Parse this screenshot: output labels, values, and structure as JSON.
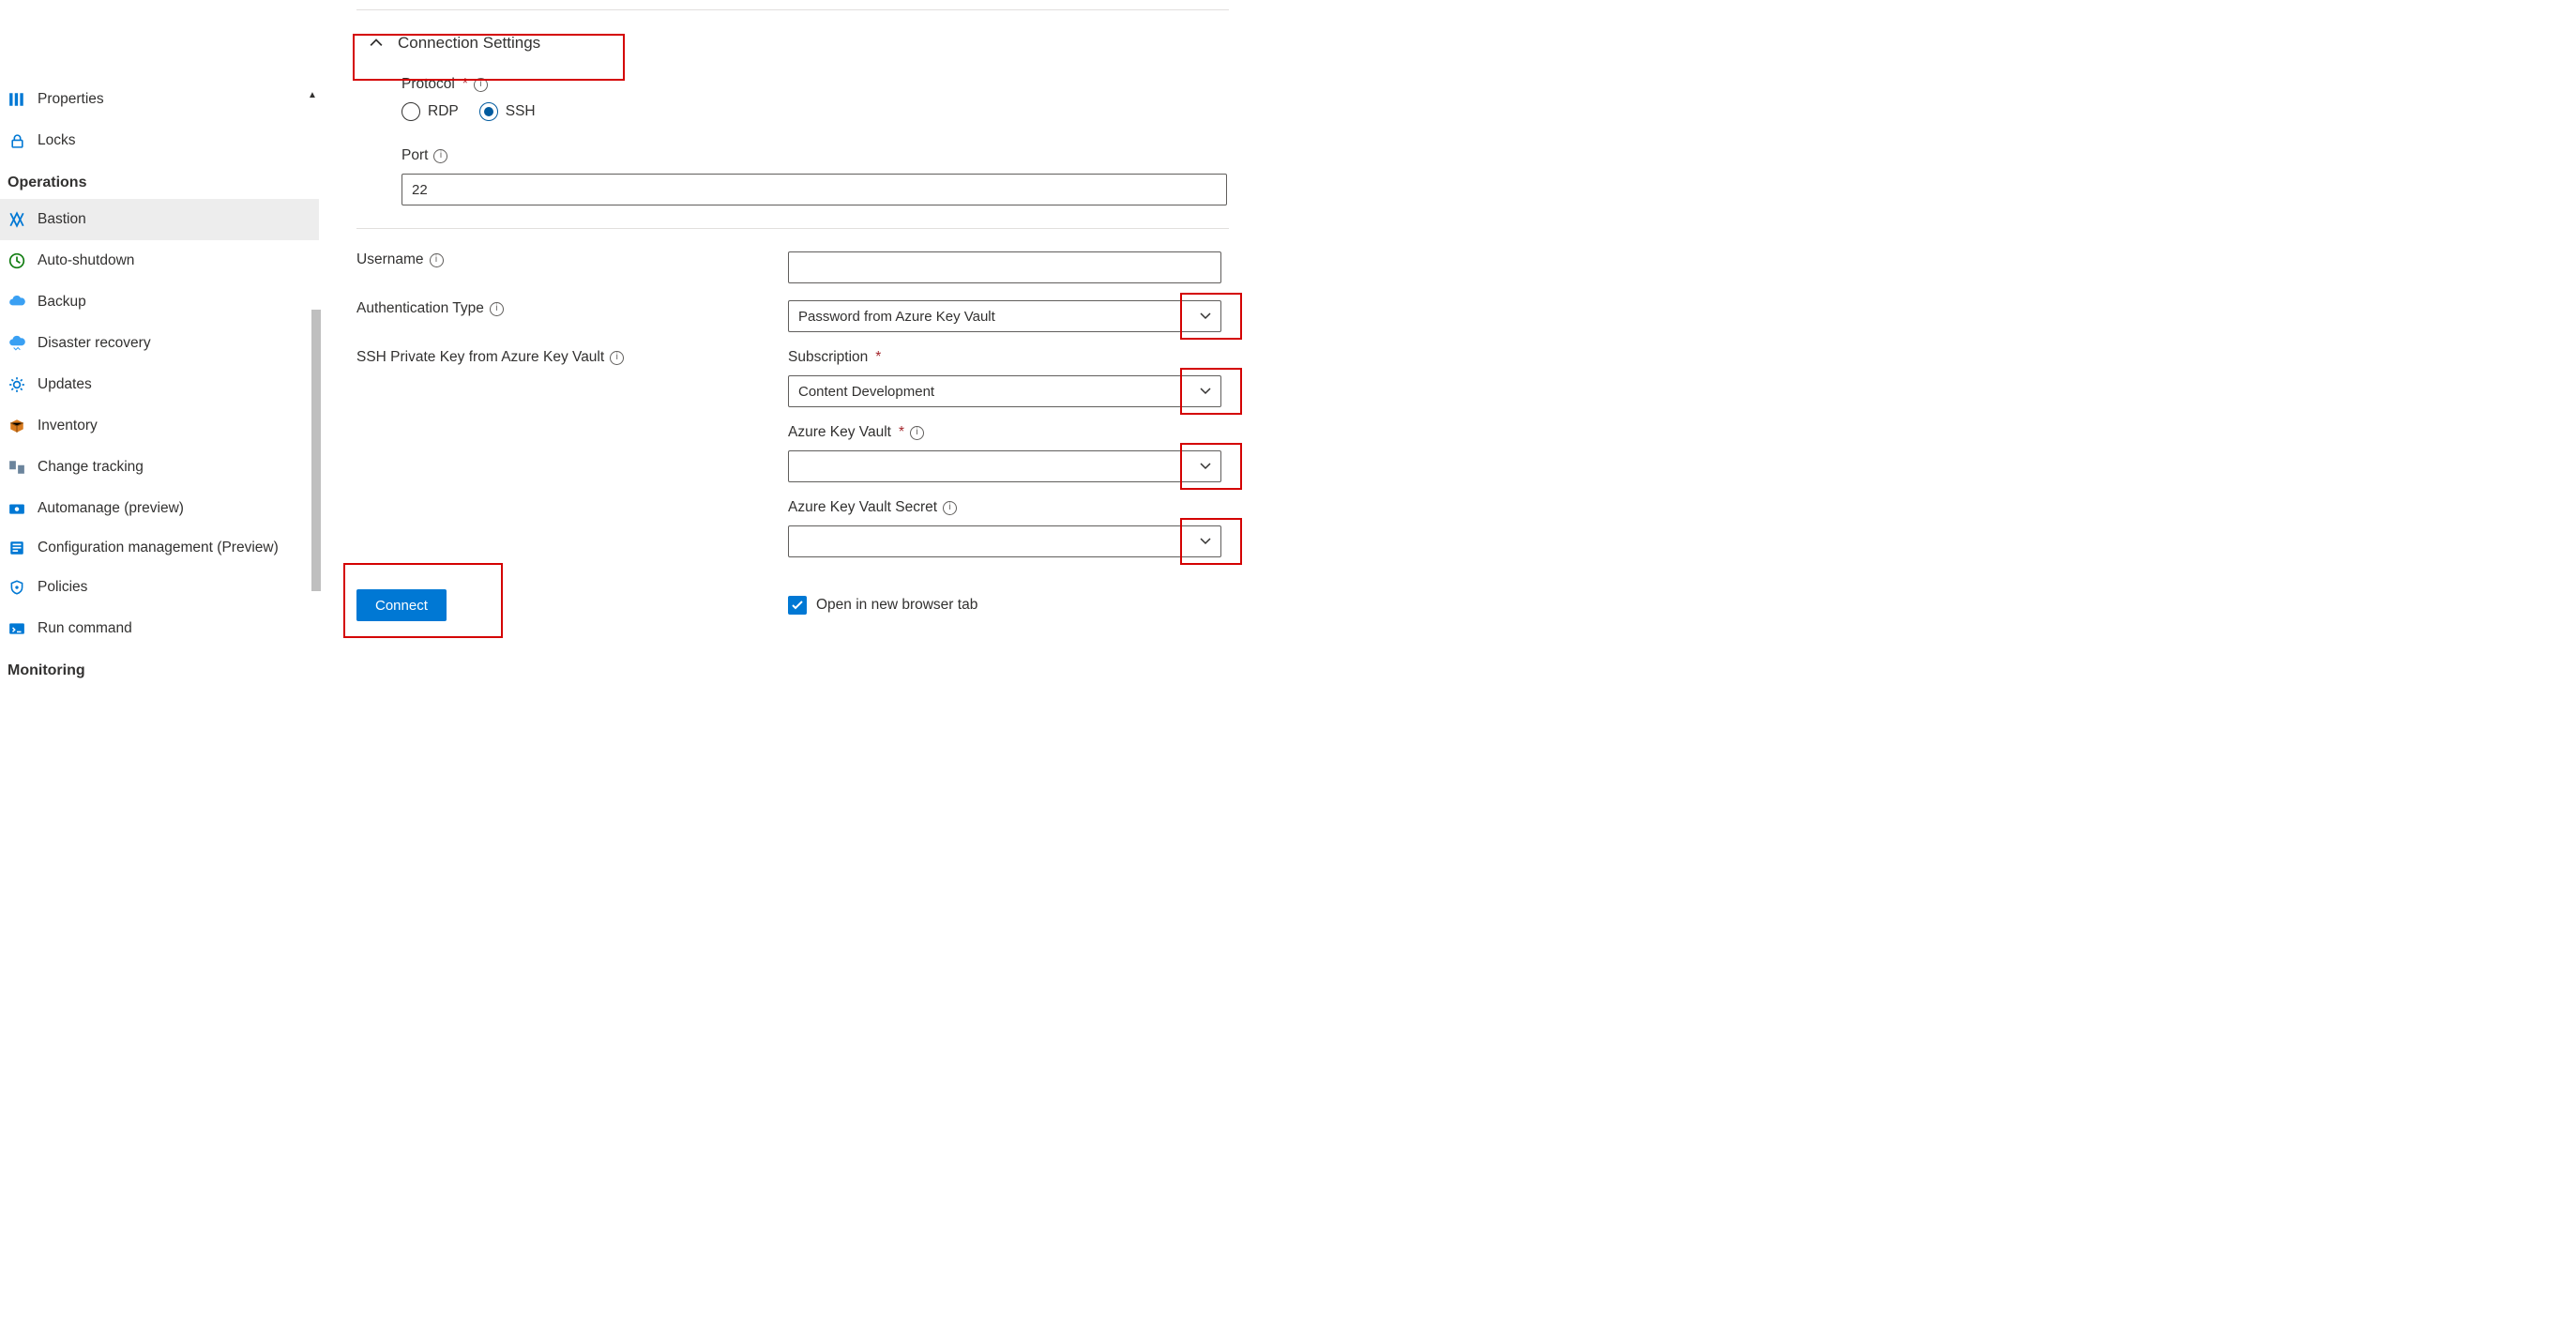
{
  "sidebar": {
    "items_before_ops": [
      {
        "key": "properties",
        "label": "Properties"
      },
      {
        "key": "locks",
        "label": "Locks"
      }
    ],
    "section_ops": "Operations",
    "ops_items": [
      {
        "key": "bastion",
        "label": "Bastion",
        "selected": true
      },
      {
        "key": "auto-shutdown",
        "label": "Auto-shutdown"
      },
      {
        "key": "backup",
        "label": "Backup"
      },
      {
        "key": "disaster",
        "label": "Disaster recovery"
      },
      {
        "key": "updates",
        "label": "Updates"
      },
      {
        "key": "inventory",
        "label": "Inventory"
      },
      {
        "key": "change-track",
        "label": "Change tracking"
      },
      {
        "key": "automanage",
        "label": "Automanage (preview)"
      },
      {
        "key": "config-mgmt",
        "label": "Configuration management (Preview)"
      },
      {
        "key": "policies",
        "label": "Policies"
      },
      {
        "key": "run-command",
        "label": "Run command"
      }
    ],
    "section_monitoring": "Monitoring"
  },
  "expander": {
    "title": "Connection Settings"
  },
  "protocol": {
    "label": "Protocol",
    "options": {
      "rdp": "RDP",
      "ssh": "SSH"
    },
    "selected": "ssh"
  },
  "port": {
    "label": "Port",
    "value": "22"
  },
  "username": {
    "label": "Username",
    "value": ""
  },
  "auth_type": {
    "label": "Authentication Type",
    "value": "Password from Azure Key Vault"
  },
  "kv_group_label": "SSH Private Key from Azure Key Vault",
  "subscription": {
    "label": "Subscription",
    "value": "Content Development"
  },
  "akv": {
    "label": "Azure Key Vault",
    "value": ""
  },
  "akv_secret": {
    "label": "Azure Key Vault Secret",
    "value": ""
  },
  "open_new_tab": {
    "label": "Open in new browser tab",
    "checked": true
  },
  "connect_button": "Connect"
}
